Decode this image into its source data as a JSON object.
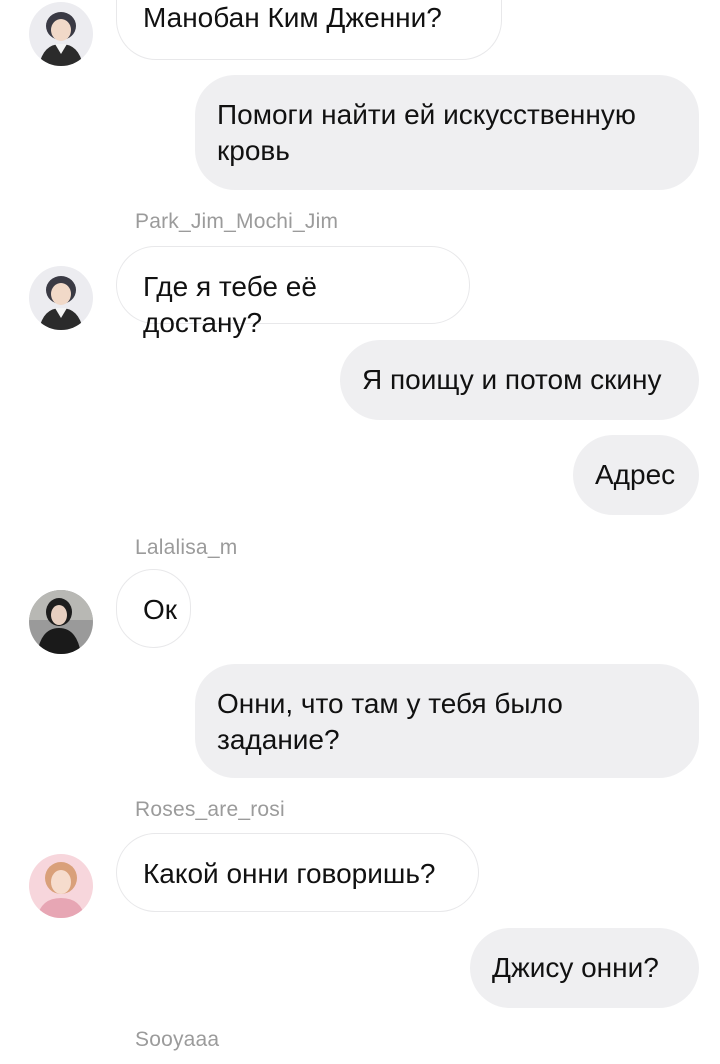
{
  "messages": [
    {
      "dir": "in",
      "text": "Манобан Ким Дженни?"
    },
    {
      "dir": "out",
      "text": "Помоги найти ей искусственную кровь"
    },
    {
      "dir": "sender",
      "text": "Park_Jim_Mochi_Jim"
    },
    {
      "dir": "in",
      "text": "Где я тебе её достану?"
    },
    {
      "dir": "out",
      "text": "Я поищу и потом скину"
    },
    {
      "dir": "out",
      "text": "Адрес"
    },
    {
      "dir": "sender",
      "text": "Lalalisa_m"
    },
    {
      "dir": "in",
      "text": "Ок"
    },
    {
      "dir": "out",
      "text": "Онни, что там у тебя было задание?"
    },
    {
      "dir": "sender",
      "text": "Roses_are_rosi"
    },
    {
      "dir": "in",
      "text": "Какой онни говоришь?"
    },
    {
      "dir": "out",
      "text": "Джису онни?"
    },
    {
      "dir": "sender",
      "text": "Sooyaaa"
    }
  ],
  "avatars": [
    {
      "user": "Park_Jim_Mochi_Jim",
      "icon": "avatar-jimin-icon",
      "color": "#e9e9ef"
    },
    {
      "user": "Lalalisa_m",
      "icon": "avatar-lisa-icon",
      "color": "#8e8e8e"
    },
    {
      "user": "Roses_are_rosi",
      "icon": "avatar-rose-icon",
      "color": "#f3c9d0"
    }
  ]
}
